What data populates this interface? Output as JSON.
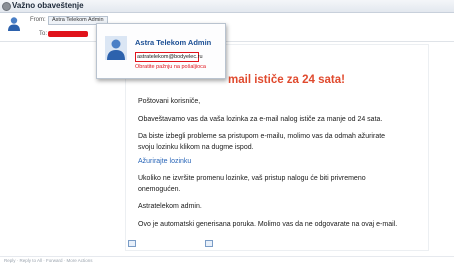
{
  "window": {
    "title": "Važno obaveštenje"
  },
  "header": {
    "from_label": "From:",
    "from_value": "Astra Telekom Admin",
    "to_label": "To:"
  },
  "contact_card": {
    "name": "Astra Telekom Admin",
    "email": "astratelekom@bodyelec.ru",
    "warning": "Obratite pažnju na pošaljioca"
  },
  "message": {
    "headline": "mail ističe za 24 sata!",
    "greeting": "Poštovani korisniče,",
    "p1": "Obaveštavamo vas da vaša lozinka za e-mail nalog ističe za manje od 24 sata.",
    "p2_line1": "Da biste izbegli probleme sa pristupom e-mailu, molimo vas da odmah ažurirate",
    "p2_line2": "svoju lozinku klikom na dugme ispod.",
    "link": "Ažurirajte lozinku",
    "p3_line1": "Ukoliko ne izvršite promenu lozinke, vaš pristup nalogu će biti privremeno",
    "p3_line2": "onemogućen.",
    "signature": "Astratelekom admin.",
    "p4": "Ovo je automatski generisana poruka. Molimo vas da ne odgovarate na ovaj e-mail."
  },
  "footer": {
    "actions": "Reply · Reply to All · Forward · More Actions"
  },
  "colors": {
    "accent_red": "#e0131b",
    "headline": "#e04a2e",
    "link": "#2a66b8",
    "name_blue": "#1c4f94"
  }
}
